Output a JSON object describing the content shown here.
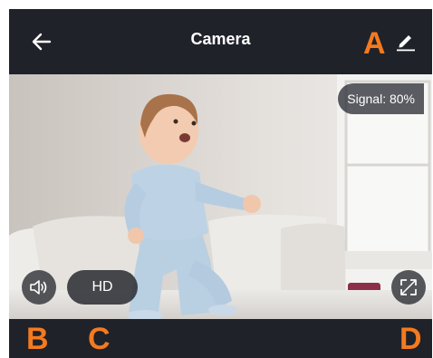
{
  "header": {
    "title": "Camera",
    "back_icon": "arrow-left-icon",
    "edit_icon": "pencil-edit-icon"
  },
  "video": {
    "signal_label": "Signal: 80%",
    "quality_label": "HD",
    "volume_icon": "speaker-volume-icon",
    "fullscreen_icon": "fullscreen-expand-icon"
  },
  "annotations": {
    "a": "A",
    "b": "B",
    "c": "C",
    "d": "D"
  },
  "colors": {
    "bar_background": "#1f2229",
    "annotation_orange": "#f47a1f"
  }
}
